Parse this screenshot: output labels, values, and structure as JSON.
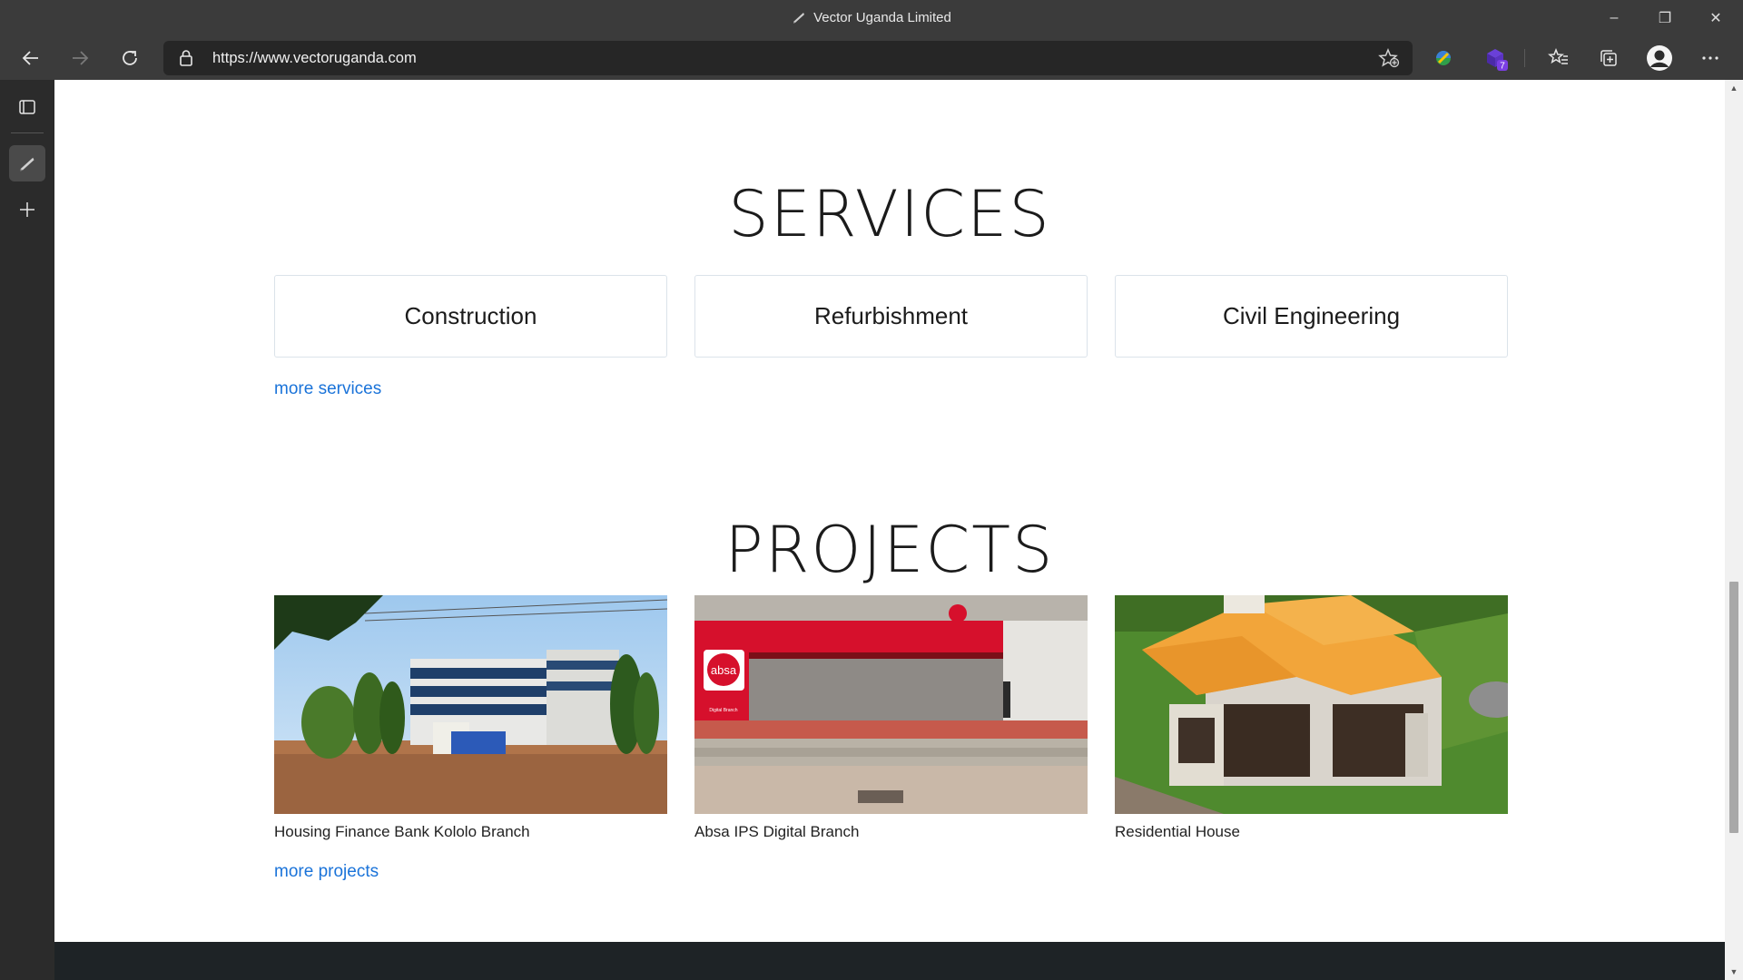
{
  "window": {
    "title": "Vector Uganda Limited",
    "controls": {
      "minimize": "–",
      "restore": "❐",
      "close": "✕"
    }
  },
  "toolbar": {
    "url": "https://www.vectoruganda.com",
    "extension_badge": "7"
  },
  "page": {
    "services": {
      "heading": "SERVICES",
      "cards": [
        "Construction",
        "Refurbishment",
        "Civil Engineering"
      ],
      "more_link": "more services"
    },
    "projects": {
      "heading": "PROJECTS",
      "items": [
        {
          "caption": "Housing Finance Bank Kololo Branch",
          "image_icon": "office-building-photo"
        },
        {
          "caption": "Absa IPS Digital Branch",
          "image_icon": "bank-branch-photo",
          "sign_text": "absa",
          "sign_small": "Digital Branch"
        },
        {
          "caption": "Residential House",
          "image_icon": "house-render"
        }
      ],
      "more_link": "more projects"
    }
  },
  "colors": {
    "link": "#1a73d9",
    "chrome_bg": "#3b3b3b",
    "footer": "#1e2326",
    "absa_red": "#d0102b"
  }
}
